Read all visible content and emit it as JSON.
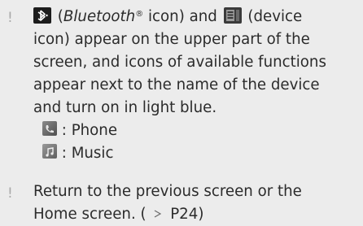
{
  "bullet_char": "!",
  "item1": {
    "bluetooth_label": "Bluetooth",
    "reg_mark": "®",
    "icon_word_1": "icon) and",
    "open_paren": "(",
    "line1_end": "(device",
    "line2": "icon) appear on the upper part of the",
    "line3": "screen, and icons of available functions",
    "line4": "appear next to the name of the device",
    "line5": "and turn on in light blue.",
    "phone_label": " : Phone",
    "music_label": " : Music"
  },
  "item2": {
    "line1": "Return to the previous screen or the",
    "line2_prefix": "Home screen. (",
    "ref": "P24)"
  },
  "icons": {
    "bluetooth": "bluetooth-icon",
    "device": "device-icon",
    "phone": "phone-icon",
    "music": "music-icon",
    "arrow": "reference-arrow-icon"
  },
  "colors": {
    "bullet": "#a9a9a9",
    "text": "#2b2b2b",
    "background": "#ececec"
  }
}
